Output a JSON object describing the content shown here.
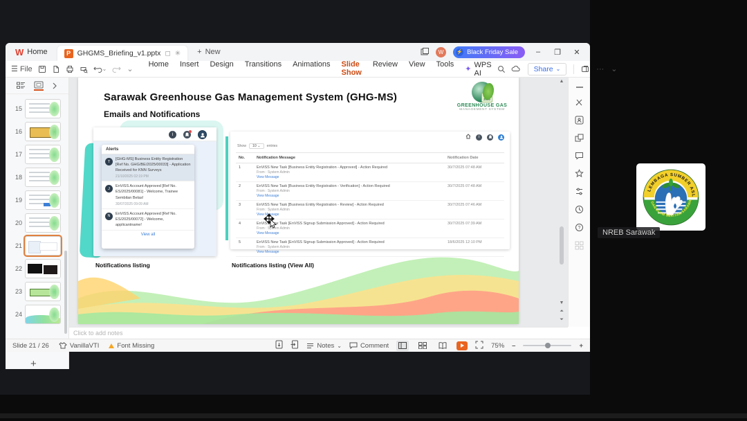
{
  "app": {
    "home_tab": "Home",
    "doc_tab": "GHGMS_Briefing_v1.pptx",
    "new_tab": "New",
    "promo": "Black Friday Sale",
    "file_label": "File",
    "menus": [
      "Home",
      "Insert",
      "Design",
      "Transitions",
      "Animations",
      "Slide Show",
      "Review",
      "View",
      "Tools"
    ],
    "wps_ai": "WPS AI",
    "share": "Share",
    "accent_color": "#cc4b14",
    "promo_gradient": [
      "#3f7bf7",
      "#8a5cf5"
    ]
  },
  "icons": {
    "hamburger": "☰",
    "minimize": "–",
    "maximize": "❐",
    "close": "✕",
    "plus": "+",
    "chevron_down": "⌄",
    "more": "···",
    "modified_star": "✳",
    "bolt": "⚡",
    "up_arrow": "▲",
    "down_arrow": "▼",
    "prev_slide": "⏶",
    "next_slide": "⏷",
    "info": "i",
    "letter_w": "W",
    "letter_p": "P"
  },
  "panel": {
    "slides": [
      {
        "number": "15"
      },
      {
        "number": "16"
      },
      {
        "number": "17"
      },
      {
        "number": "18"
      },
      {
        "number": "19"
      },
      {
        "number": "20"
      },
      {
        "number": "21"
      },
      {
        "number": "22"
      },
      {
        "number": "23"
      },
      {
        "number": "24"
      }
    ],
    "selected_number": "21"
  },
  "slide": {
    "title": "Sarawak Greenhouse Gas Management System (GHG-MS)",
    "subtitle": "Emails and Notifications",
    "logo": {
      "badge": "NET 2050",
      "line1": "GREENHOUSE GAS",
      "line2": "MANAGEMENT SYSTEM"
    },
    "caption_left": "Notifications listing",
    "caption_right": "Notifications listing (View All)",
    "alerts": {
      "header": "Alerts",
      "view_all": "View all",
      "items": [
        {
          "initial": "T",
          "text": "[GHG-MS] Business Entity Registration [Ref No. GHG/BE/2025/00033] - Application Received for KNN Surveys",
          "date": "21/10/2025 02:19 PM"
        },
        {
          "initial": "J",
          "text": "EnViSS Account Approved [Ref No. ES/2025/00081] - Welcome, Trainee Sembilan Belas!",
          "date": "30/07/2025 09:09 AM"
        },
        {
          "initial": "N",
          "text": "EnViSS Account Approved [Ref No. ES/2025/00072] - Welcome, applicantname!",
          "date": ""
        }
      ]
    },
    "table": {
      "show_label": "Show",
      "show_value": "10",
      "entries_label": "entries",
      "headers": {
        "no": "No.",
        "message": "Notification Message",
        "date": "Notification Date"
      },
      "rows": [
        {
          "no": "1",
          "message": "EnViSS New Task [Business Entity Registration - Approved] - Action Required",
          "from": "From : System Admin",
          "link": "View Message",
          "date": "30/7/2025 07:48 AM"
        },
        {
          "no": "2",
          "message": "EnViSS New Task [Business Entity Registration - Verification] - Action Required",
          "from": "From : System Admin",
          "link": "View Message",
          "date": "30/7/2025 07:48 AM"
        },
        {
          "no": "3",
          "message": "EnViSS New Task [Business Entity Registration - Review] - Action Required",
          "from": "From : System Admin",
          "link": "View Message",
          "date": "30/7/2025 07:46 AM"
        },
        {
          "no": "4",
          "message": "EnViSS New Task [EnViSS Signup Submission Approved] - Action Required",
          "from": "From : System Admin",
          "link": "View Message",
          "date": "30/7/2025 07:39 AM"
        },
        {
          "no": "5",
          "message": "EnViSS New Task [EnViSS Signup Submission Approved] - Action Required",
          "from": "From : System Admin",
          "link": "View Message",
          "date": "18/6/2025 12:10 PM"
        }
      ]
    }
  },
  "notes": {
    "placeholder": "Click to add notes"
  },
  "statusbar": {
    "slide_info": "Slide 21 / 26",
    "theme_name": "VanillaVTI",
    "font_missing": "Font Missing",
    "notes_label": "Notes",
    "comment_label": "Comment",
    "zoom_level": "75%"
  },
  "participant": {
    "name": "NREB Sarawak",
    "logo_text_top": "LEMBAGA SUMBER ASLI",
    "logo_text_bottom": "DAN ALAM SEKITAR SARAWAK"
  }
}
